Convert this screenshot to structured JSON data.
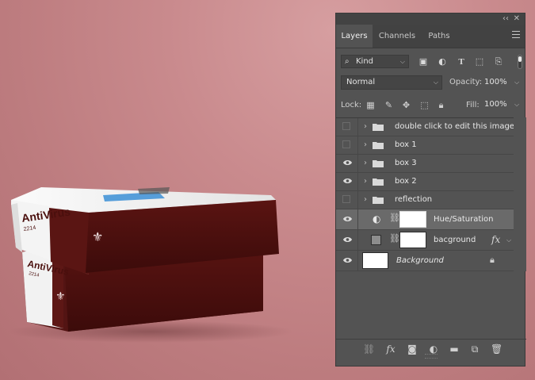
{
  "product": {
    "brand": "AntiVirus",
    "year": "2214",
    "brand_lower": "AntiVirus",
    "year_lower": "2214",
    "accent_color": "#4a0f0d"
  },
  "panel": {
    "collapse_glyph": "‹‹",
    "close_glyph": "✕",
    "tabs": [
      "Layers",
      "Channels",
      "Paths"
    ],
    "active_tab": "Layers",
    "filter": {
      "icon": "search-icon",
      "label": "Kind"
    },
    "filter_icons": [
      "image-filter-icon",
      "adjustment-filter-icon",
      "type-filter-icon",
      "shape-filter-icon",
      "smart-object-filter-icon"
    ],
    "blend_mode": "Normal",
    "opacity_label": "Opacity:",
    "opacity_value": "100%",
    "lock_label": "Lock:",
    "lock_icons": [
      "lock-transparent-icon",
      "lock-paint-icon",
      "lock-position-icon",
      "lock-artboard-icon",
      "lock-all-icon"
    ],
    "fill_label": "Fill:",
    "fill_value": "100%",
    "layers": [
      {
        "name": "double click to edit this image",
        "type": "group",
        "visible": false
      },
      {
        "name": "box 1",
        "type": "group",
        "visible": false
      },
      {
        "name": "box 3",
        "type": "group",
        "visible": true
      },
      {
        "name": "box 2",
        "type": "group",
        "visible": true
      },
      {
        "name": "reflection",
        "type": "group",
        "visible": false
      },
      {
        "name": "Hue/Saturation",
        "type": "adjustment",
        "visible": true,
        "selected": true
      },
      {
        "name": "bacground",
        "type": "fill",
        "visible": true,
        "fx": "fx"
      },
      {
        "name": "Background",
        "type": "background",
        "visible": true,
        "locked": true
      }
    ],
    "bottom_icons": [
      "link-layers-icon",
      "fx-icon",
      "add-mask-icon",
      "new-adjustment-icon",
      "new-group-icon",
      "new-layer-icon",
      "delete-layer-icon"
    ],
    "fx_label": "fx"
  }
}
